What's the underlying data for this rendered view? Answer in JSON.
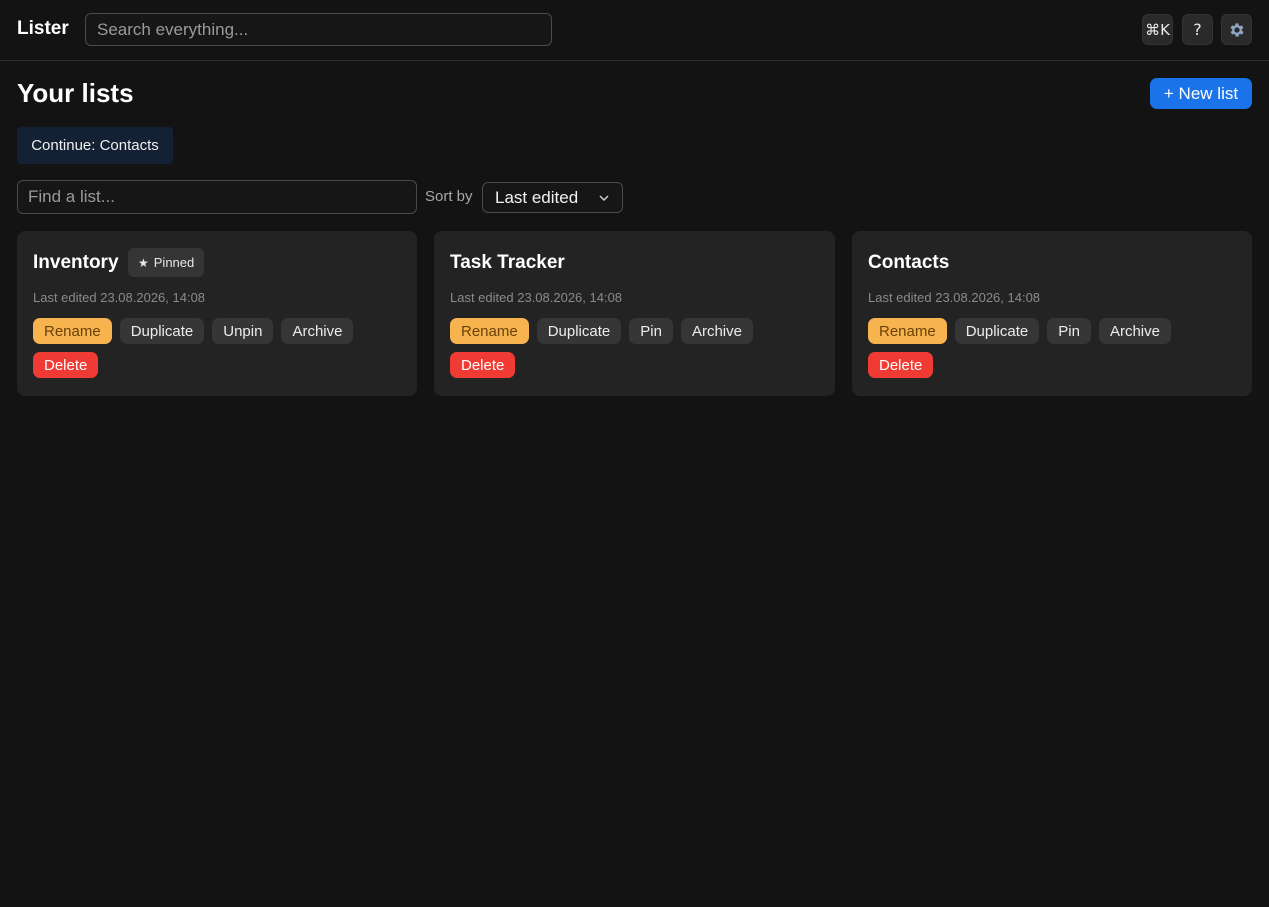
{
  "app": {
    "name": "Lister"
  },
  "header": {
    "search_placeholder": "Search everything...",
    "shortcut_label": "⌘K",
    "help_label": "?",
    "settings_icon": "gear-icon"
  },
  "main": {
    "title": "Your lists",
    "new_list_label": "+ New list",
    "continue_label": "Continue: Contacts",
    "find_placeholder": "Find a list...",
    "sort_label": "Sort by",
    "sort_value": "Last edited"
  },
  "colors": {
    "accent": "#1a73e8",
    "rename": "#f6b34e",
    "delete": "#ef3b34",
    "card_bg": "#232323",
    "page_bg": "#131313"
  },
  "cards": [
    {
      "title": "Inventory",
      "pinned_badge": "Pinned",
      "meta": "Last edited 23.08.2026, 14:08",
      "actions": {
        "rename": "Rename",
        "duplicate": "Duplicate",
        "pin": "Unpin",
        "archive": "Archive",
        "delete": "Delete"
      }
    },
    {
      "title": "Task Tracker",
      "meta": "Last edited 23.08.2026, 14:08",
      "actions": {
        "rename": "Rename",
        "duplicate": "Duplicate",
        "pin": "Pin",
        "archive": "Archive",
        "delete": "Delete"
      }
    },
    {
      "title": "Contacts",
      "meta": "Last edited 23.08.2026, 14:08",
      "actions": {
        "rename": "Rename",
        "duplicate": "Duplicate",
        "pin": "Pin",
        "archive": "Archive",
        "delete": "Delete"
      }
    }
  ]
}
